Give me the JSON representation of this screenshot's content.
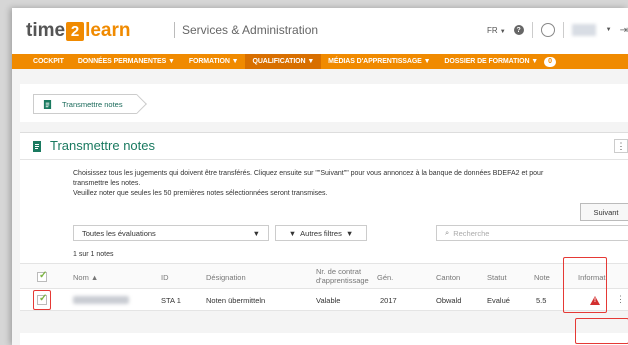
{
  "header": {
    "logo_time": "time",
    "logo_two": "2",
    "logo_learn": "learn",
    "title": "Services & Administration",
    "language": "FR"
  },
  "nav": {
    "items": [
      {
        "label": "COCKPIT"
      },
      {
        "label": "DONNÉES PERMANENTES ▼"
      },
      {
        "label": "FORMATION ▼"
      },
      {
        "label": "QUALIFICATION ▼"
      },
      {
        "label": "MÉDIAS D'APPRENTISSAGE ▼"
      },
      {
        "label": "DOSSIER DE FORMATION ▼"
      }
    ],
    "badge": "0",
    "active_index": 3
  },
  "breadcrumb": {
    "label": "Transmettre notes"
  },
  "panel": {
    "title": "Transmettre notes",
    "menu_icon": "⋮",
    "desc_line1": "Choisissez tous les jugements qui doivent être transférés. Cliquez ensuite sur \"\"Suivant\"\" pour vous annoncez à la banque de données BDEFA2 et pour",
    "desc_line2": "transmettre les notes.",
    "desc_line3": "Veuillez noter que seules les 50 premières notes sélectionnées seront transmises."
  },
  "filters": {
    "evaluation_select": "Toutes les évaluations",
    "other_filters": "Autres filtres",
    "search_placeholder": "Recherche"
  },
  "table": {
    "count": "1 sur 1 notes",
    "headers": {
      "name": "Nom ▲",
      "id": "ID",
      "designation": "Désignation",
      "contract_line1": "Nr. de contrat",
      "contract_line2": "d'apprentissage",
      "gen": "Gén.",
      "canton": "Canton",
      "statut": "Statut",
      "note": "Note",
      "info": "Informati"
    },
    "rows": [
      {
        "id": "STA 1",
        "designation": "Noten übermitteln",
        "contract": "Valable",
        "gen": "2017",
        "canton": "Obwald",
        "statut": "Evalué",
        "note": "5.5"
      }
    ]
  },
  "actions": {
    "next": "Suivant"
  },
  "colors": {
    "accent": "#f08a00",
    "green": "#1a7a60",
    "highlight": "#e53935",
    "warning": "#d32f2f"
  }
}
